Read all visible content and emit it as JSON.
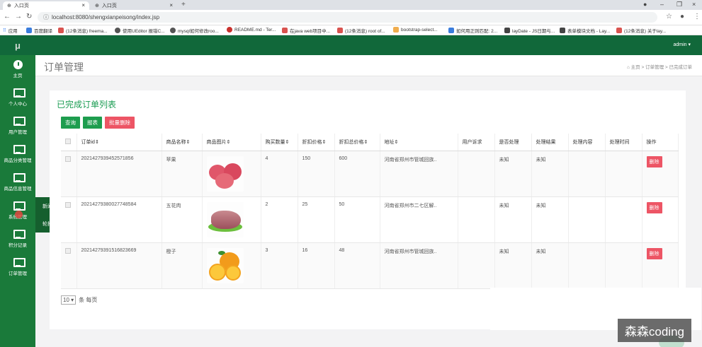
{
  "browser": {
    "tabs": [
      {
        "label": "入口页"
      },
      {
        "label": "入口页"
      }
    ],
    "url": "localhost:8080/shengxianpeisong/index.jsp",
    "bookmarks": [
      "应用",
      "百度翻译",
      "(12条消息) freema...",
      "使用UEditor 报错C...",
      "mysql如何修改roo...",
      "README.md - Ter...",
      "在java web项目中...",
      "(12条消息) root of...",
      "bootstrap-select...",
      "如何用正则匹配: 2...",
      "layDate - JS日期与...",
      "表单模块文档 - Lay...",
      "(12条消息) 关于lay..."
    ]
  },
  "sidebar": {
    "logo": "μ",
    "items": [
      {
        "label": "主页",
        "icon": "dashboard-icon"
      },
      {
        "label": "个人中心",
        "icon": "monitor-icon"
      },
      {
        "label": "用户管理",
        "icon": "monitor-icon"
      },
      {
        "label": "商品分类管理",
        "icon": "monitor-icon"
      },
      {
        "label": "商品信息管理",
        "icon": "monitor-icon"
      },
      {
        "label": "系统管理",
        "icon": "monitor-icon"
      },
      {
        "label": "积分记录",
        "icon": "monitor-icon"
      },
      {
        "label": "订单管理",
        "icon": "monitor-icon"
      }
    ],
    "flyout": [
      "新闻资讯",
      "轮播图管理"
    ]
  },
  "topbar": {
    "user": "admin ▾"
  },
  "header": {
    "title": "订单管理",
    "breadcrumb": "⌂ 主页 > 订单管理 > 已完成订单"
  },
  "card": {
    "title": "已完成订单列表",
    "buttons": {
      "query": "查询",
      "report": "报表",
      "batch_delete": "批量删除"
    }
  },
  "table": {
    "columns": [
      "订单id⇕",
      "商品名称⇕",
      "商品图片⇕",
      "购买数量⇕",
      "折扣价格⇕",
      "折扣总价格⇕",
      "地址⇕",
      "用户诉求",
      "是否处理",
      "处理结果",
      "处理内容",
      "处理时间",
      "操作"
    ],
    "rows": [
      {
        "id": "2021427939452571856",
        "name": "苹果",
        "qty": "4",
        "price": "150",
        "total": "600",
        "address": "河南省郑州市管城回族..",
        "demand": "",
        "handled": "未知",
        "result": "未知",
        "content": "",
        "time": "",
        "action": "删除"
      },
      {
        "id": "20214279380027748584",
        "name": "五花肉",
        "qty": "2",
        "price": "25",
        "total": "50",
        "address": "河南省郑州市二七区解..",
        "demand": "",
        "handled": "未知",
        "result": "未知",
        "content": "",
        "time": "",
        "action": "删除"
      },
      {
        "id": "20214279391516823669",
        "name": "橙子",
        "qty": "3",
        "price": "16",
        "total": "48",
        "address": "河南省郑州市管城回族..",
        "demand": "",
        "handled": "未知",
        "result": "未知",
        "content": "",
        "time": "",
        "action": "删除"
      }
    ]
  },
  "pager": {
    "page_size": "10",
    "suffix": "条 每页"
  },
  "watermark": "森森coding",
  "colors": {
    "sidebar": "#1a7a3a",
    "accent": "#1d9d4e",
    "danger": "#ed5565"
  }
}
